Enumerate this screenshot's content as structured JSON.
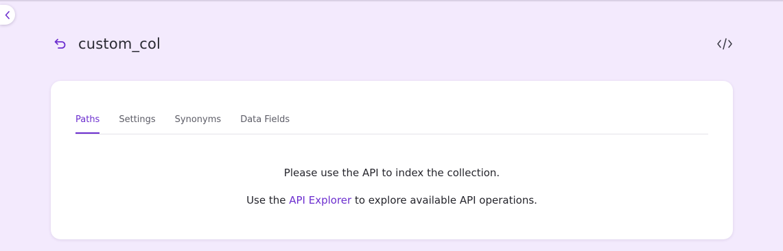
{
  "page": {
    "title": "custom_col"
  },
  "icons": {
    "collapse": "chevron-left-icon",
    "back": "undo-arrow-icon",
    "code": "code-brackets-icon"
  },
  "colors": {
    "background": "#f3eafd",
    "accent": "#6c2ecf",
    "card": "#ffffff"
  },
  "tabs": [
    {
      "label": "Paths",
      "active": true
    },
    {
      "label": "Settings",
      "active": false
    },
    {
      "label": "Synonyms",
      "active": false
    },
    {
      "label": "Data Fields",
      "active": false
    }
  ],
  "content": {
    "line1": "Please use the API to index the collection.",
    "line2_prefix": "Use the ",
    "line2_link": "API Explorer",
    "line2_suffix": " to explore available API operations."
  }
}
